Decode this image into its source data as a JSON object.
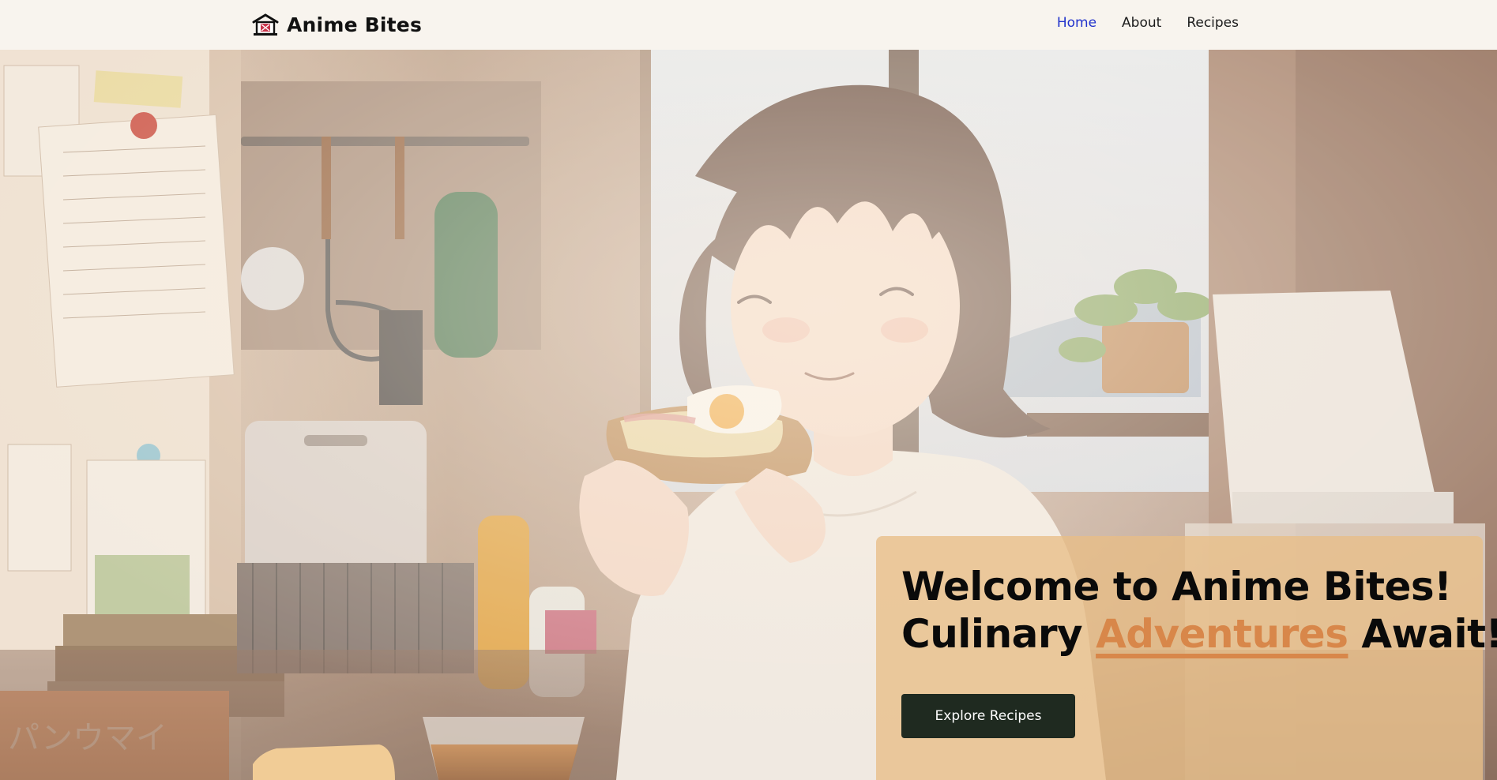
{
  "brand": {
    "name": "Anime Bites",
    "icon": "house-icon"
  },
  "nav": {
    "items": [
      {
        "label": "Home",
        "active": true
      },
      {
        "label": "About",
        "active": false
      },
      {
        "label": "Recipes",
        "active": false
      }
    ]
  },
  "hero": {
    "image": "anime-girl-eating-egg-toast",
    "headline_line1": "Welcome to Anime Bites!",
    "headline_line2_pre": "Culinary ",
    "headline_line2_accent": "Adventures",
    "headline_line2_post": " Await!",
    "cta_label": "Explore Recipes"
  },
  "colors": {
    "nav_active": "#2233cc",
    "accent": "#d8874a",
    "cta_bg": "#1f2a20",
    "card_bg": "#e8be86"
  }
}
